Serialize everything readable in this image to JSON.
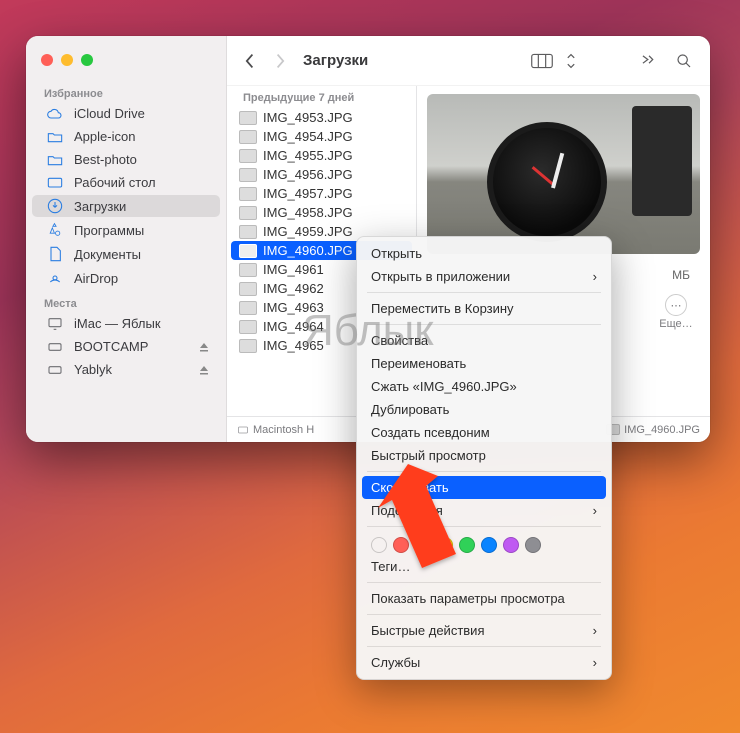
{
  "window": {
    "title": "Загрузки"
  },
  "sidebar": {
    "section_favorites": "Избранное",
    "section_locations": "Места",
    "items": [
      {
        "label": "iCloud Drive",
        "icon": "cloud"
      },
      {
        "label": "Apple-icon",
        "icon": "folder"
      },
      {
        "label": "Best-photo",
        "icon": "folder"
      },
      {
        "label": "Рабочий стол",
        "icon": "desktop"
      },
      {
        "label": "Загрузки",
        "icon": "download",
        "active": true
      },
      {
        "label": "Программы",
        "icon": "apps"
      },
      {
        "label": "Документы",
        "icon": "doc"
      },
      {
        "label": "AirDrop",
        "icon": "airdrop"
      }
    ],
    "locations": [
      {
        "label": "iMac — Яблык",
        "icon": "display"
      },
      {
        "label": "BOOTCAMP",
        "icon": "disk",
        "eject": true
      },
      {
        "label": "Yablyk",
        "icon": "disk",
        "eject": true
      }
    ]
  },
  "list": {
    "group_header": "Предыдущие 7 дней",
    "files": [
      "IMG_4953.JPG",
      "IMG_4954.JPG",
      "IMG_4955.JPG",
      "IMG_4956.JPG",
      "IMG_4957.JPG",
      "IMG_4958.JPG",
      "IMG_4959.JPG",
      "IMG_4960.JPG",
      "IMG_4961",
      "IMG_4962",
      "IMG_4963",
      "IMG_4964",
      "IMG_4965"
    ],
    "selected_index": 7
  },
  "preview": {
    "size_suffix": "МБ",
    "more_label": "Еще…"
  },
  "pathbar": {
    "root": "Macintosh H",
    "leaf": "IMG_4960.JPG"
  },
  "context_menu": {
    "open": "Открыть",
    "open_with": "Открыть в приложении",
    "move_to_trash": "Переместить в Корзину",
    "get_info": "Свойства",
    "rename": "Переименовать",
    "compress": "Сжать «IMG_4960.JPG»",
    "duplicate": "Дублировать",
    "make_alias": "Создать псевдоним",
    "quick_look": "Быстрый просмотр",
    "copy": "Скопировать",
    "share": "Поделиться",
    "tags": "Теги…",
    "view_options": "Показать параметры просмотра",
    "quick_actions": "Быстрые действия",
    "services": "Службы",
    "tag_colors": [
      "#ffffff",
      "#ff5f57",
      "#ff9f0a",
      "#ffd60a",
      "#30d158",
      "#0a84ff",
      "#bf5af2",
      "#8e8e93"
    ]
  },
  "watermark": "Яблык"
}
